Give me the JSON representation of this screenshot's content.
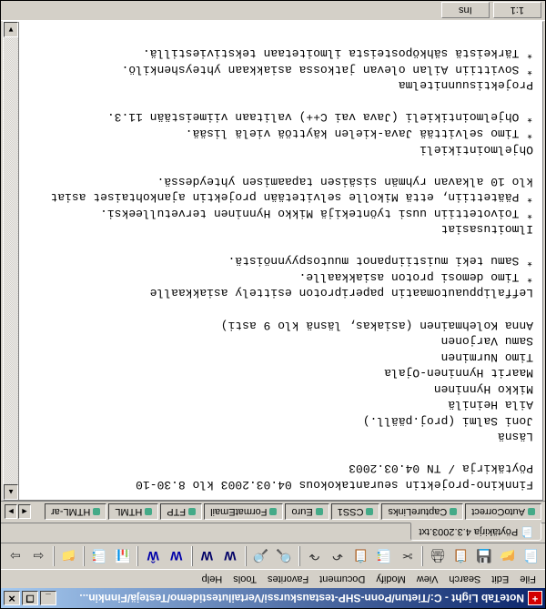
{
  "titlebar": {
    "app_icon_text": "+",
    "title": "NoteTab Light - C:/Tietun/Ponn-SHP-testauskurssi/Vertailutestidemo/Testejä/Finnkin..."
  },
  "menubar": {
    "items": [
      "File",
      "Edit",
      "Search",
      "View",
      "Modify",
      "Document",
      "Favorites",
      "Tools",
      "Help"
    ]
  },
  "toolbar": {
    "buttons": [
      "📄",
      "📂",
      "💾",
      "📋",
      "🖨",
      "✂",
      "📑",
      "📋",
      "↶",
      "↷",
      "|",
      "🔍",
      "🔎",
      "|",
      "W",
      "W",
      "|",
      "W",
      "Ŵ",
      "|",
      "📊",
      "📑",
      "|",
      "📁",
      "|",
      "⇦",
      "⇨"
    ]
  },
  "doc_tabs": {
    "items": [
      {
        "icon": "📄",
        "label": "Pöytäkirja 4.3.2003.txt"
      }
    ]
  },
  "clip_tabs": {
    "items": [
      "AutoCorrect",
      "CaptureLinks",
      "CSS1",
      "Euro",
      "FormatEmail",
      "FTP",
      "HTML",
      "HTML-ar"
    ]
  },
  "editor": {
    "lines": [
      "Finnkino-projektin seurantakokous 04.03.2003 klo 8.30-10",
      "Pöytäkirja / TN 04.03.2003",
      "",
      "Läsnä",
      "Joni Salmi (proj.pääll.)",
      "Aila Heinilä",
      "Mikko Hynninen",
      "Maarit Hynninen-Ojala",
      "Timo Nurminen",
      "Samu Varjonen",
      "Anna Kolehmainen (asiakas, läsnä klo 9 asti)",
      "",
      "Leffalippuautomaatin paperiproton esittely asiakkaalle",
      "* Timo demosi proton asiakkaalle.",
      "* Samu teki muistiinpanot muutospyynnöistä.",
      "",
      "Ilmoitusasiat",
      "* Toivotettiin uusi työntekijä Mikko Hynninen tervetulleeksi.",
      "* Päätettiin, että Mikolle selvitetään projektin ajankohtaiset asiat",
      "klo 10 alkavan ryhmän sisäisen tapaamisen yhteydessä.",
      "",
      "Ohjelmointikieli",
      "* Timo selvittää Java-kielen käyttöä vielä lisää.",
      "* Ohjelmointikieli (Java vai C++) valitaan viimeistään 11.3.",
      "",
      "Projektisuunnitelma",
      "* Sovittiin Ailan olevan jatkossa asiakkaan yhteyshenkilö.",
      "* Tärkeistä sähköposteista ilmoitetaan tekstiviestillä."
    ]
  },
  "statusbar": {
    "cells": [
      "1:1",
      "Ins"
    ]
  }
}
